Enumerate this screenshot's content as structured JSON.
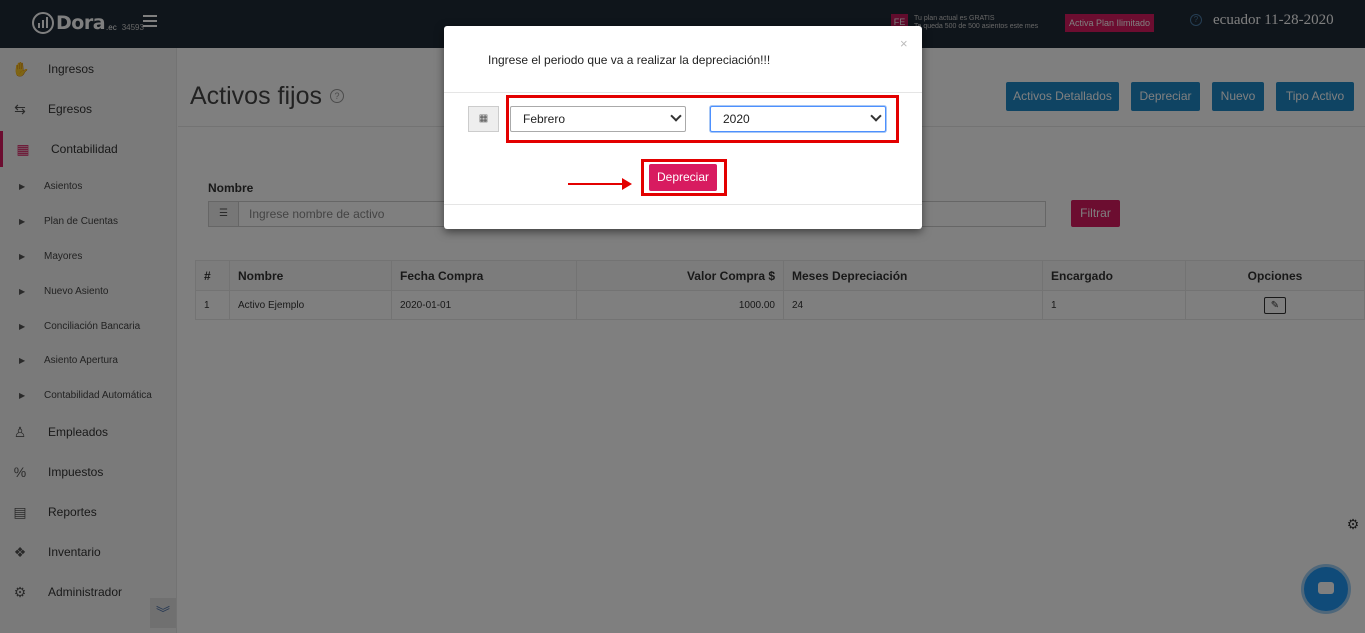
{
  "topbar": {
    "logo_text": "Dora",
    "logo_suffix": ".ec",
    "logo_number": "34593",
    "fe_badge": "FE",
    "plan_line1": "Tu plan actual es GRATIS",
    "plan_line2": "Te queda 500 de 500 asientos este mes",
    "plan_button": "Activa Plan Ilimitado",
    "help_icon": "?",
    "date_text": "ecuador 11-28-2020"
  },
  "sidebar": {
    "items": [
      {
        "label": "Ingresos",
        "icon": "hand-coin-icon"
      },
      {
        "label": "Egresos",
        "icon": "transfer-icon"
      },
      {
        "label": "Contabilidad",
        "icon": "calculator-icon"
      }
    ],
    "sub_items": [
      {
        "label": "Asientos"
      },
      {
        "label": "Plan de Cuentas"
      },
      {
        "label": "Mayores"
      },
      {
        "label": "Nuevo Asiento"
      },
      {
        "label": "Conciliación Bancaria"
      },
      {
        "label": "Asiento Apertura"
      },
      {
        "label": "Contabilidad Automática"
      }
    ],
    "items_bottom": [
      {
        "label": "Empleados",
        "icon": "people-icon"
      },
      {
        "label": "Impuestos",
        "icon": "tax-icon"
      },
      {
        "label": "Reportes",
        "icon": "report-icon"
      },
      {
        "label": "Inventario",
        "icon": "boxes-icon"
      },
      {
        "label": "Administrador",
        "icon": "gear-icon"
      }
    ]
  },
  "main": {
    "page_title": "Activos fijos",
    "toolbar": {
      "detailed_label": "Activos Detallados",
      "depreciate_label": "Depreciar",
      "new_label": "Nuevo",
      "type_label": "Tipo Activo"
    },
    "filter": {
      "label": "Nombre",
      "placeholder": "Ingrese nombre de activo",
      "button_label": "Filtrar"
    },
    "table": {
      "headers": [
        "#",
        "Nombre",
        "Fecha Compra",
        "Valor Compra $",
        "Meses Depreciación",
        "Encargado",
        "Opciones"
      ],
      "rows": [
        {
          "num": "1",
          "name": "Activo Ejemplo",
          "date": "2020-01-01",
          "value": "1000.00",
          "months": "24",
          "manager": "1"
        }
      ]
    }
  },
  "modal": {
    "title": "Ingrese el periodo que va a realizar la depreciación!!!",
    "close": "×",
    "month_value": "Febrero",
    "year_value": "2020",
    "button_label": "Depreciar"
  },
  "colors": {
    "accent": "#d81b60",
    "primary": "#1e88c7",
    "topbar": "#1f2a36",
    "annotation": "#e30000"
  }
}
